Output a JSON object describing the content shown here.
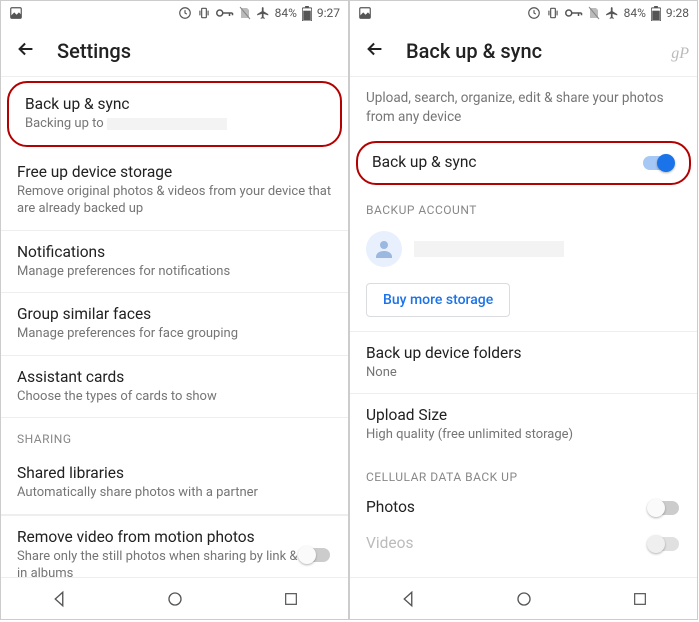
{
  "left": {
    "status": {
      "battery": "84%",
      "time": "9:27"
    },
    "title": "Settings",
    "items": [
      {
        "title": "Back up & sync",
        "sub": "Backing up to "
      },
      {
        "title": "Free up device storage",
        "sub": "Remove original photos & videos from your device that are already backed up"
      },
      {
        "title": "Notifications",
        "sub": "Manage preferences for notifications"
      },
      {
        "title": "Group similar faces",
        "sub": "Manage preferences for face grouping"
      },
      {
        "title": "Assistant cards",
        "sub": "Choose the types of cards to show"
      }
    ],
    "section_sharing": "SHARING",
    "shared_libs": {
      "title": "Shared libraries",
      "sub": "Automatically share photos with a partner"
    },
    "remove_video": {
      "title": "Remove video from motion photos",
      "sub": "Share only the still photos when sharing by link & in albums"
    }
  },
  "right": {
    "status": {
      "battery": "84%",
      "time": "9:28"
    },
    "title": "Back up & sync",
    "watermark": "gP",
    "desc": "Upload, search, organize, edit & share your photos from any device",
    "toggle_label": "Back up & sync",
    "section_account": "BACKUP ACCOUNT",
    "buy_more": "Buy more storage",
    "folders": {
      "title": "Back up device folders",
      "sub": "None"
    },
    "upload": {
      "title": "Upload Size",
      "sub": "High quality (free unlimited storage)"
    },
    "section_cellular": "CELLULAR DATA BACK UP",
    "photos_label": "Photos",
    "videos_label": "Videos"
  }
}
